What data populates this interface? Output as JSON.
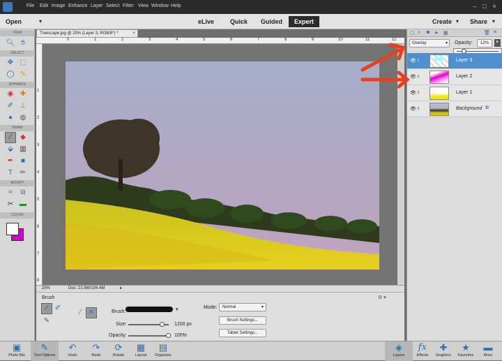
{
  "menu": {
    "items": [
      "File",
      "Edit",
      "Image",
      "Enhance",
      "Layer",
      "Select",
      "Filter",
      "View",
      "Window",
      "Help"
    ]
  },
  "modebar": {
    "open": "Open",
    "tabs": [
      "eLive",
      "Quick",
      "Guided",
      "Expert"
    ],
    "active_tab": "Expert",
    "create": "Create",
    "share": "Share"
  },
  "toolbar": {
    "view": "VIEW",
    "select": "SELECT",
    "enhance": "ENHANCE",
    "draw": "DRAW",
    "modify": "MODIFY",
    "color": "COLOR"
  },
  "document": {
    "tab_title": "Treescape.jpg @ 25% (Layer 3, RGB/8*) *",
    "ruler_top": [
      "0",
      "1",
      "2",
      "3",
      "4",
      "5",
      "6",
      "7",
      "8",
      "9",
      "10",
      "11",
      "12"
    ],
    "ruler_left": [
      "1",
      "2",
      "3",
      "4",
      "5",
      "6",
      "7",
      "8"
    ],
    "zoom": "25%",
    "doc_size": "Doc: 22.8M/104.4M"
  },
  "options": {
    "title": "Brush",
    "brush_label": "Brush:",
    "size_label": "Size:",
    "size_value": "1200 px",
    "size_fraction": 0.85,
    "opacity_label": "Opacity:",
    "opacity_value": "100%",
    "opacity_fraction": 1.0,
    "mode_label": "Mode:",
    "mode_value": "Normal",
    "brush_settings": "Brush Settings...",
    "tablet_settings": "Tablet Settings..."
  },
  "layers": {
    "blend_mode": "Overlay",
    "opacity_label": "Opacity:",
    "opacity_value": "12%",
    "items": [
      {
        "name": "Layer 3",
        "selected": true
      },
      {
        "name": "Layer 2",
        "selected": false
      },
      {
        "name": "Layer 1",
        "selected": false
      },
      {
        "name": "Background",
        "selected": false
      }
    ]
  },
  "bottombar": {
    "left": [
      "Photo Bin",
      "Tool Options",
      "Undo",
      "Redo",
      "Rotate",
      "Layout",
      "Organizer"
    ],
    "right": [
      "Layers",
      "Effects",
      "Graphics",
      "Favorites",
      "More"
    ]
  },
  "colors": {
    "accent": "#2d6fb3",
    "arrow": "#e8401e",
    "selected_layer": "#4e8fd0",
    "foreground": "#ffffff",
    "background": "#d000d0"
  }
}
